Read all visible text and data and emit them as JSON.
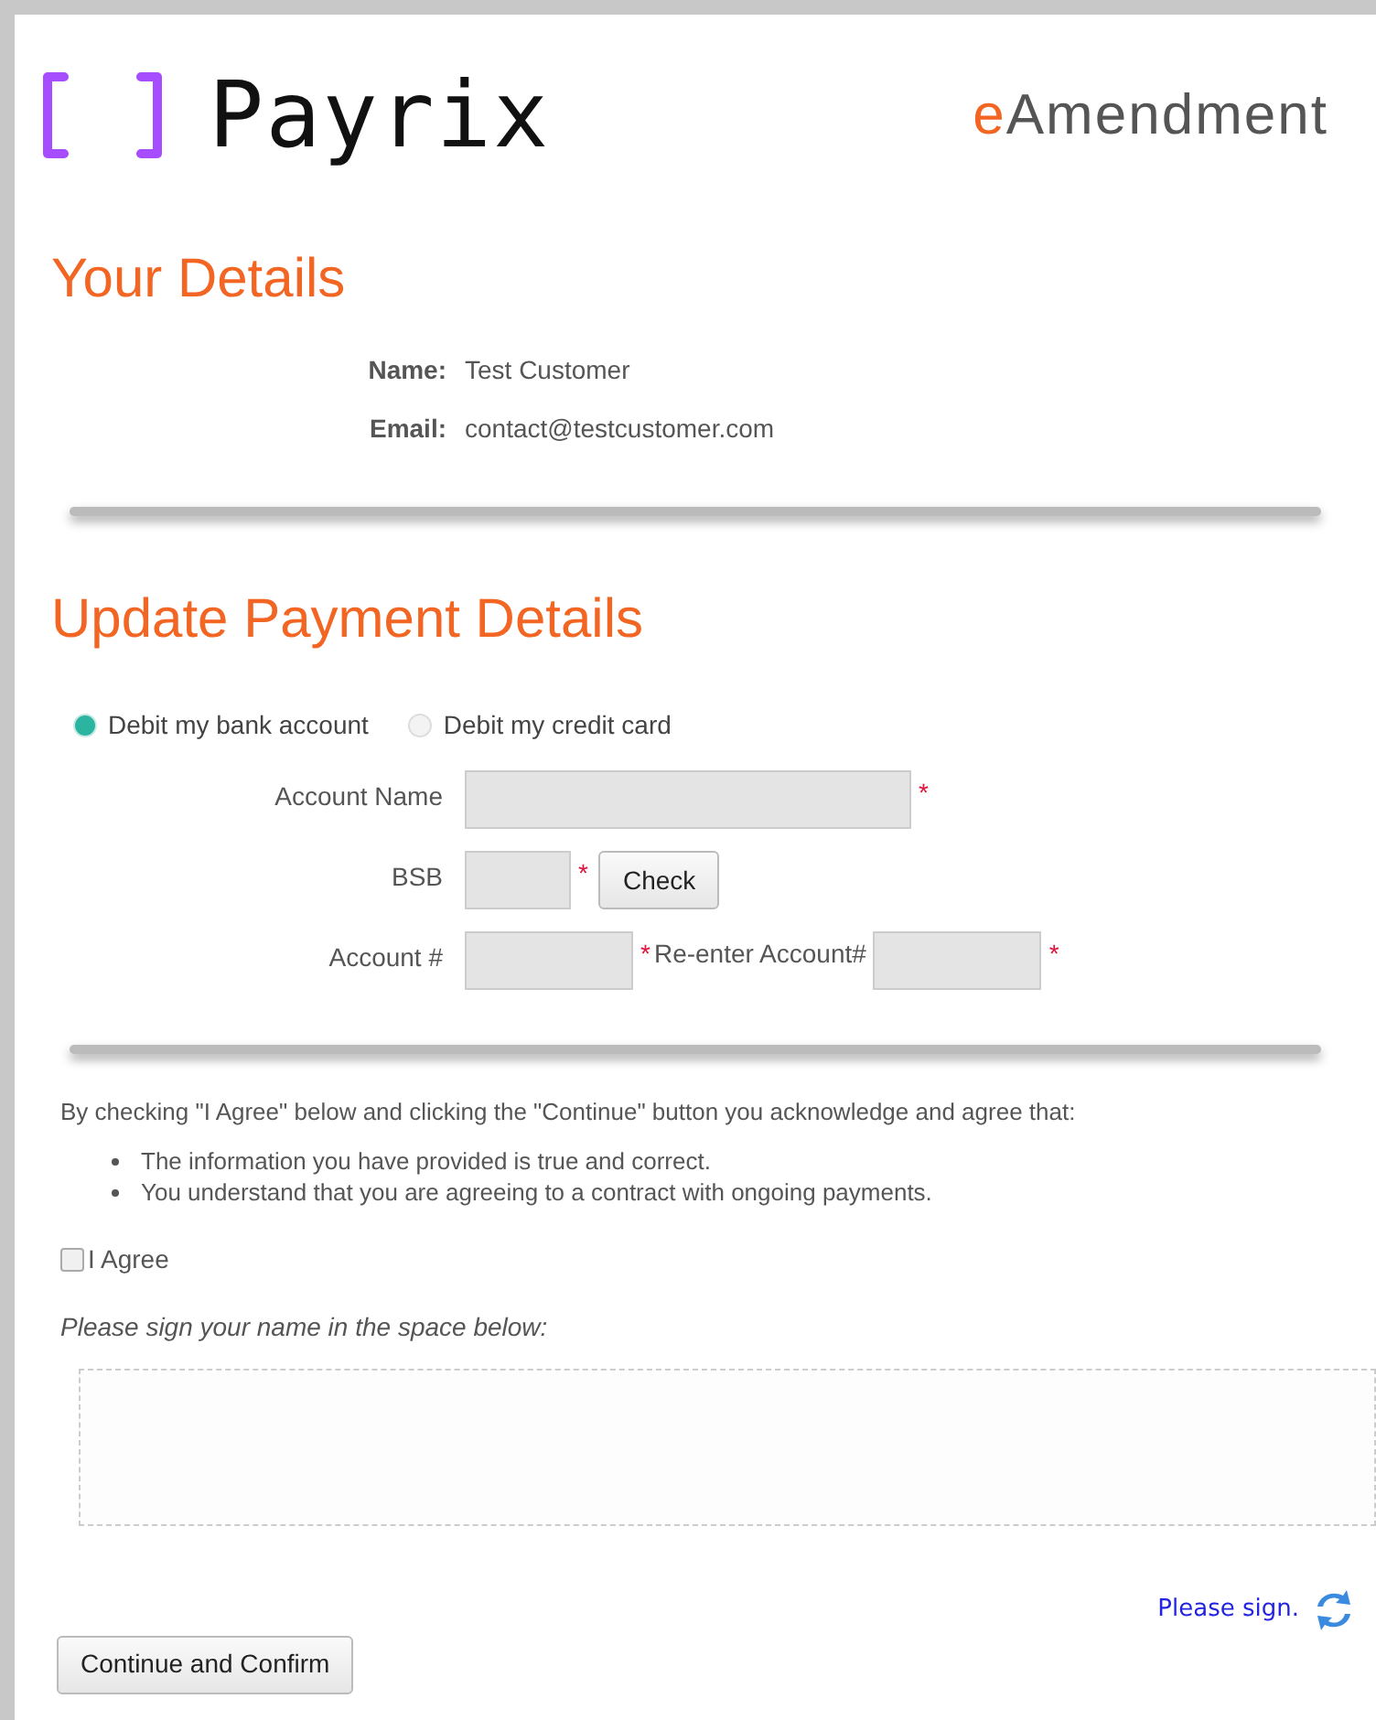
{
  "header": {
    "brand": "Payrix",
    "title_prefix": "e",
    "title": "Amendment"
  },
  "your_details": {
    "heading": "Your Details",
    "fields": [
      {
        "label": "Name:",
        "value": "Test Customer"
      },
      {
        "label": "Email:",
        "value": "contact@testcustomer.com"
      }
    ]
  },
  "payment": {
    "heading": "Update Payment Details",
    "methods": [
      {
        "label": "Debit my bank account",
        "selected": true
      },
      {
        "label": "Debit my credit card",
        "selected": false
      }
    ],
    "account_name": {
      "label": "Account Name",
      "required": "*"
    },
    "bsb": {
      "label": "BSB",
      "required": "*",
      "button": "Check"
    },
    "account_number": {
      "label": "Account #",
      "required": "*",
      "reenter_label": "Re-enter Account#",
      "reenter_required": "*"
    }
  },
  "agreement": {
    "intro": "By checking \"I Agree\" below and clicking the \"Continue\" button you acknowledge and agree that:",
    "points": [
      "The information you have provided is true and correct.",
      "You understand that you are agreeing to a contract with ongoing payments."
    ],
    "agree": {
      "label": "I Agree",
      "checked": false
    },
    "sign_prompt": "Please sign your name in the space below:",
    "sign_status": "Please sign."
  },
  "submit": "Continue and Confirm"
}
